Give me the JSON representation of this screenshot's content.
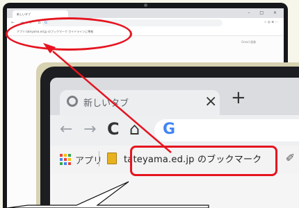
{
  "small": {
    "tab_title": "新しいタブ",
    "nav_icons": "← → ⟳ ⌂",
    "url_text": "G",
    "ext_text": "☆ ◎ ⊕ ⋯",
    "bookmarks": "アプリ    tateyama.ed.jp のブックマーク    ガイドラインに準拠",
    "links": "Gmail  画像"
  },
  "big": {
    "tab_title": "新しいタブ",
    "close": "×",
    "newtab": "+",
    "back": "←",
    "forward": "→",
    "reload": "C",
    "home": "⌂",
    "omnibox_logo": "G",
    "apps_label": "アプリ",
    "bookmark_label": "tateyama.ed.jp のブックマーク",
    "pencil": "✐"
  },
  "colors": {
    "annotation": "#e5141f",
    "folder": "#e8b21f",
    "google_blue": "#4285f4"
  }
}
